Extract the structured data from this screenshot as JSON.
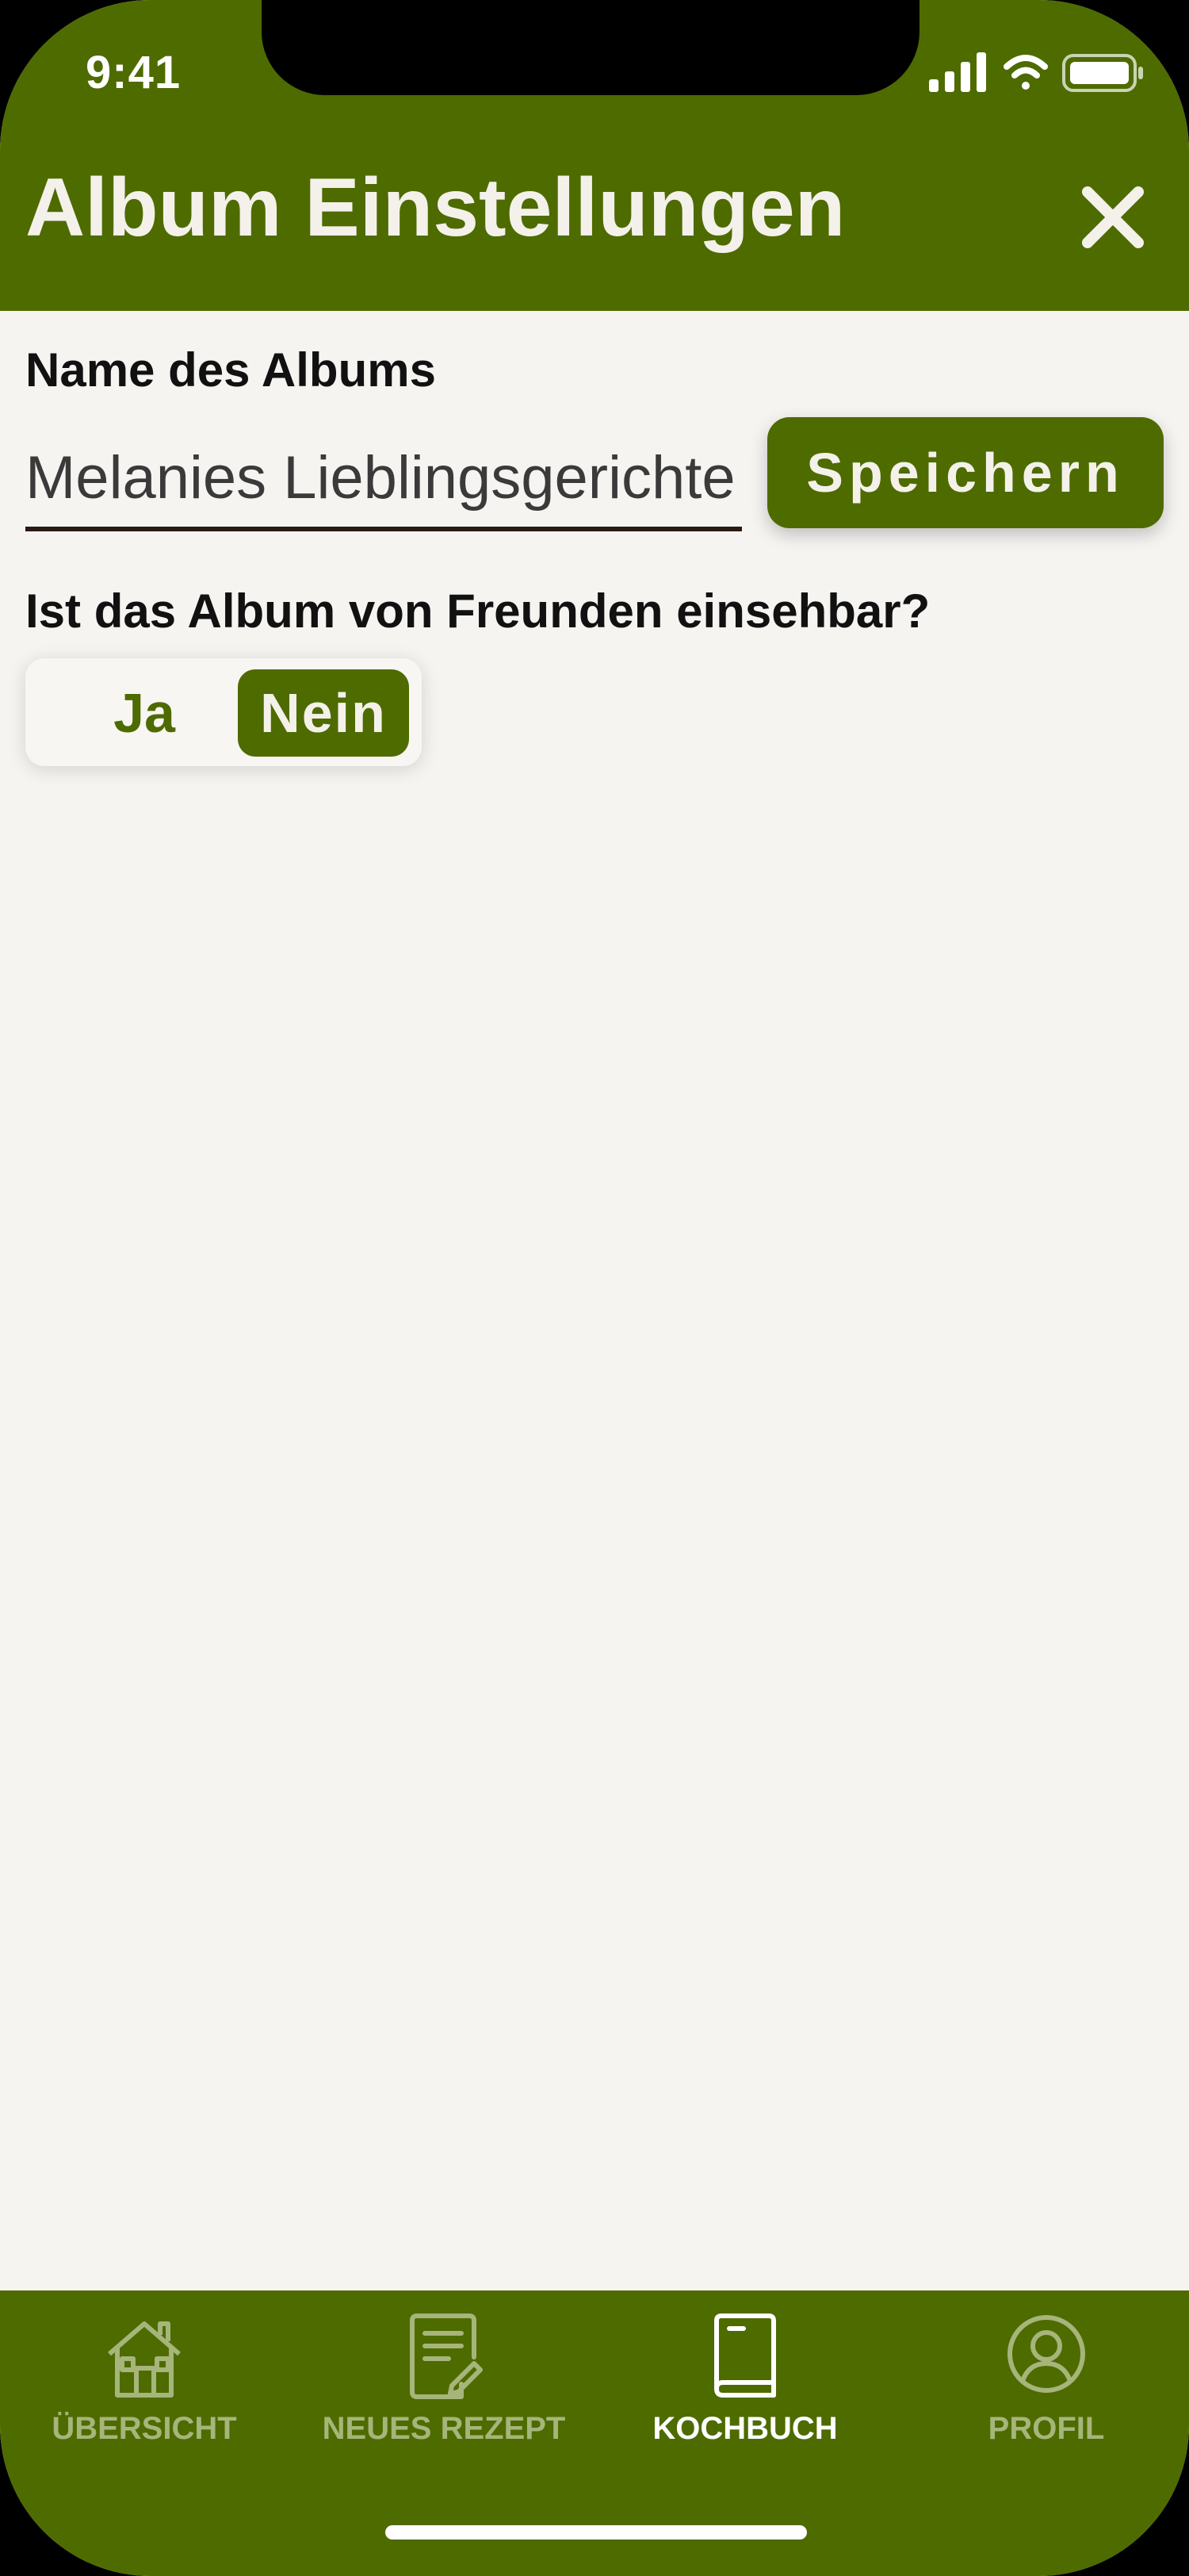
{
  "status_bar": {
    "time": "9:41",
    "icons": [
      "cellular-signal-icon",
      "wifi-icon",
      "battery-icon"
    ]
  },
  "header": {
    "title": "Album Einstellungen",
    "close_icon": "close-icon"
  },
  "form": {
    "name_label": "Name des Albums",
    "name_value": "Melanies Lieblingsgerichte",
    "save_label": "Speichern",
    "visibility_question": "Ist das Album von Freunden einsehbar?",
    "toggle": {
      "yes_label": "Ja",
      "no_label": "Nein",
      "selected": "Nein"
    }
  },
  "bottom_nav": {
    "items": [
      {
        "label": "ÜBERSICHT",
        "icon": "house-icon",
        "active": false
      },
      {
        "label": "NEUES REZEPT",
        "icon": "recipe-note-icon",
        "active": false
      },
      {
        "label": "KOCHBUCH",
        "icon": "book-icon",
        "active": true
      },
      {
        "label": "PROFIL",
        "icon": "profile-icon",
        "active": false
      }
    ]
  },
  "colors": {
    "primary_green": "#4e6b00",
    "background": "#f6f4f1",
    "inactive_nav": "#a6b57a",
    "light_text": "#f4f1ea"
  }
}
